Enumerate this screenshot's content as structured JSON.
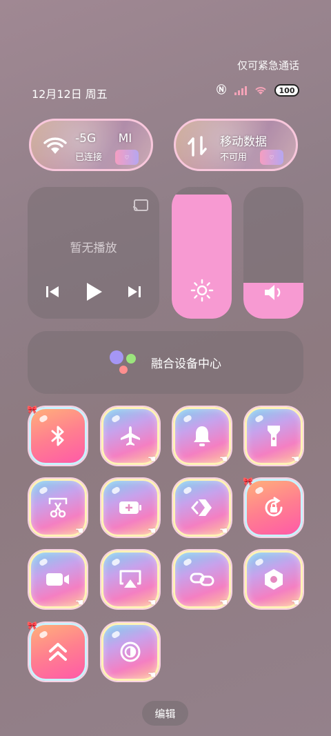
{
  "status_bar": {
    "carrier_text": "仅可紧急通话",
    "date": "12月12日 周五",
    "battery": "100"
  },
  "connectivity": {
    "wifi": {
      "title": "-5G",
      "title_suffix": "MI",
      "subtitle": "已连接"
    },
    "mobile_data": {
      "title": "移动数据",
      "subtitle": "不可用"
    }
  },
  "media": {
    "status": "暂无播放"
  },
  "sliders": {
    "brightness_level": 0.94,
    "volume_level": 0.27
  },
  "fusion": {
    "label": "融合设备中心"
  },
  "tiles": [
    {
      "icon": "bluetooth-icon",
      "active": true
    },
    {
      "icon": "airplane-icon",
      "active": false
    },
    {
      "icon": "bell-icon",
      "active": false
    },
    {
      "icon": "flashlight-icon",
      "active": false
    },
    {
      "icon": "screenshot-scissors-icon",
      "active": false
    },
    {
      "icon": "battery-saver-icon",
      "active": false
    },
    {
      "icon": "nearby-share-icon",
      "active": false
    },
    {
      "icon": "rotation-lock-icon",
      "active": true
    },
    {
      "icon": "screen-record-icon",
      "active": false
    },
    {
      "icon": "screen-cast-icon",
      "active": false
    },
    {
      "icon": "link-icon",
      "active": false
    },
    {
      "icon": "settings-hexagon-icon",
      "active": false
    },
    {
      "icon": "performance-mode-icon",
      "active": true
    },
    {
      "icon": "dark-mode-icon",
      "active": false
    }
  ],
  "edit": {
    "label": "编辑"
  },
  "colors": {
    "accent_pink": "#f79ad2",
    "active_tile": "#ff7f8f"
  }
}
